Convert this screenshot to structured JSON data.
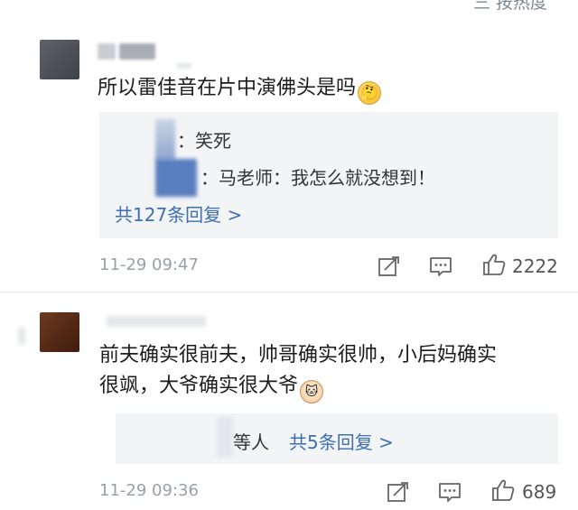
{
  "header": {
    "sort_label": "三 按热度"
  },
  "comments": [
    {
      "text": "所以雷佳音在片中演佛头是吗",
      "emoji": "thinking-emoji",
      "replies": [
        {
          "text": "：笑死"
        },
        {
          "text": "：马老师：我怎么就没想到！"
        }
      ],
      "more_replies": "共127条回复 >",
      "time": "11-29 09:47",
      "likes": "2222"
    },
    {
      "text_line1": "前夫确实很前夫，帅哥确实很帅，小后妈确实",
      "text_line2": "很飒，大爷确实很大爷",
      "emoji": "cat-emoji",
      "reply_prefix": "等人",
      "more_replies": "共5条回复 >",
      "time": "11-29 09:36",
      "likes": "689"
    }
  ],
  "colors": {
    "link": "#3e6fb2",
    "reply_bg": "#f3f4f6",
    "meta": "#9aa0a8"
  }
}
